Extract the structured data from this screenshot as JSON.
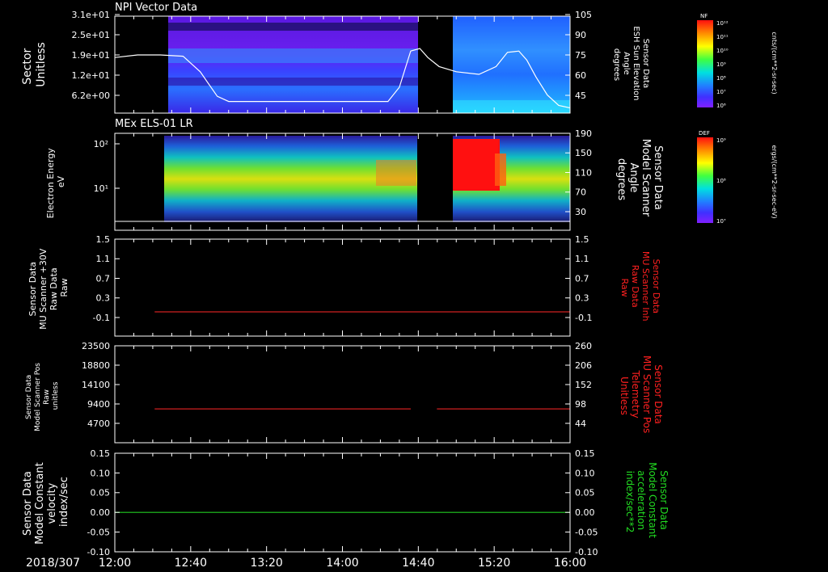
{
  "colors": {
    "background": "#000000",
    "axis": "#ffffff",
    "red_trace": "#d02020",
    "green_trace": "#22cc22",
    "label_red": "#ff2020",
    "label_green": "#22dd22"
  },
  "footer": {
    "date": "2018/307",
    "time_ticks": [
      "12:00",
      "12:40",
      "13:20",
      "14:00",
      "14:40",
      "15:20",
      "16:00"
    ]
  },
  "chart_data": [
    {
      "type": "heatmap",
      "title": "NPI Vector Data",
      "ylabel_left": [
        "Sector",
        "Unitless"
      ],
      "yticks_left": [
        "3.1e+01",
        "2.5e+01",
        "1.9e+01",
        "1.2e+01",
        "6.2e+00"
      ],
      "ylabel_right": [
        "Sensor Data",
        "ESH Sun Elevation",
        "Angle",
        "degrees"
      ],
      "yticks_right": [
        "105",
        "90",
        "75",
        "60",
        "45"
      ],
      "ylim_right": [
        30,
        105
      ],
      "colorbar": {
        "title": "NF",
        "ticks": [
          "10¹²",
          "10¹¹",
          "10¹⁰",
          "10⁹",
          "10⁸",
          "10⁷",
          "10⁶"
        ],
        "units": "cnts/(cm**2-sr-sec)"
      },
      "data_gaps_hours": [
        [
          12.0,
          12.42
        ],
        [
          14.57,
          14.83
        ]
      ],
      "overlay_line": {
        "name": "ESH Sun Elevation",
        "x_hours": [
          12.0,
          12.2,
          12.4,
          12.6,
          12.75,
          12.9,
          13.0,
          13.3,
          13.7,
          14.1,
          14.4,
          14.5,
          14.6,
          14.68,
          14.75,
          14.85,
          15.0,
          15.2,
          15.35,
          15.45,
          15.55,
          15.62,
          15.7,
          15.8,
          15.9,
          16.0
        ],
        "y": [
          73,
          75,
          75,
          74,
          62,
          43,
          39,
          39,
          39,
          39,
          39,
          50,
          78,
          80,
          73,
          66,
          62,
          60,
          66,
          77,
          78,
          71,
          58,
          44,
          36,
          34
        ]
      }
    },
    {
      "type": "heatmap",
      "title": "MEx ELS-01 LR",
      "ylabel_left": [
        "Electron Energy",
        "eV"
      ],
      "yticks_left": [
        "10²",
        "10¹"
      ],
      "ylabel_right": [
        "Sensor Data",
        "Model Scanner",
        "Angle",
        "degrees"
      ],
      "yticks_right": [
        "190",
        "150",
        "110",
        "70",
        "30"
      ],
      "ylim_right": [
        0,
        190
      ],
      "colorbar": {
        "title": "DEF",
        "ticks": [
          "10⁹",
          "10⁸",
          "10⁷"
        ],
        "units": "ergs/(cm**2-sr-sec-eV)"
      },
      "data_gaps_hours": [
        [
          12.0,
          12.4
        ],
        [
          14.57,
          14.83
        ]
      ],
      "overlay_line": {
        "name": "Model Scanner Angle",
        "x_hours": [
          12.0,
          16.0
        ],
        "y": [
          10,
          10
        ]
      }
    },
    {
      "type": "line",
      "ylabel_left": [
        "Sensor Data",
        "MU Scanner +30V",
        "Raw Data",
        "Raw"
      ],
      "yticks_left": [
        "1.5",
        "1.1",
        "0.7",
        "0.3",
        "-0.1"
      ],
      "ylim_left": [
        -0.5,
        1.5
      ],
      "ylabel_right": [
        "Sensor Data",
        "MU Scanner Inh",
        "Raw Data",
        "Raw"
      ],
      "yticks_right": [
        "1.5",
        "1.1",
        "0.7",
        "0.3",
        "-0.1"
      ],
      "series": [
        {
          "segments_hours": [
            [
              12.35,
              16.0
            ]
          ],
          "y": 0
        }
      ]
    },
    {
      "type": "line",
      "ylabel_left": [
        "Sensor Data",
        "Model Scanner Pos",
        "Raw",
        "unitless"
      ],
      "yticks_left": [
        "23500",
        "18800",
        "14100",
        "9400",
        "4700"
      ],
      "ylim_left": [
        0,
        23500
      ],
      "ylabel_right": [
        "Sensor Data",
        "MU Scanner Pos",
        "Telemetry",
        "Unitless"
      ],
      "yticks_right": [
        "260",
        "206",
        "152",
        "98",
        "44"
      ],
      "series": [
        {
          "segments_hours": [
            [
              12.35,
              14.6
            ],
            [
              14.83,
              16.0
            ]
          ],
          "y": 8200
        }
      ]
    },
    {
      "type": "line",
      "ylabel_left": [
        "Sensor Data",
        "Model Constant",
        "velocity",
        "index/sec"
      ],
      "yticks_left": [
        "0.15",
        "0.10",
        "0.05",
        "0.00",
        "-0.05",
        "-0.10"
      ],
      "ylim_left": [
        -0.1,
        0.15
      ],
      "ylabel_right": [
        "Sensor Data",
        "Model Constant",
        "acceleration",
        "index/sec**2"
      ],
      "yticks_right": [
        "0.15",
        "0.10",
        "0.05",
        "0.00",
        "-0.05",
        "-0.10"
      ],
      "series": [
        {
          "segments_hours": [
            [
              12.0,
              16.0
            ]
          ],
          "y": 0.0
        }
      ]
    }
  ]
}
